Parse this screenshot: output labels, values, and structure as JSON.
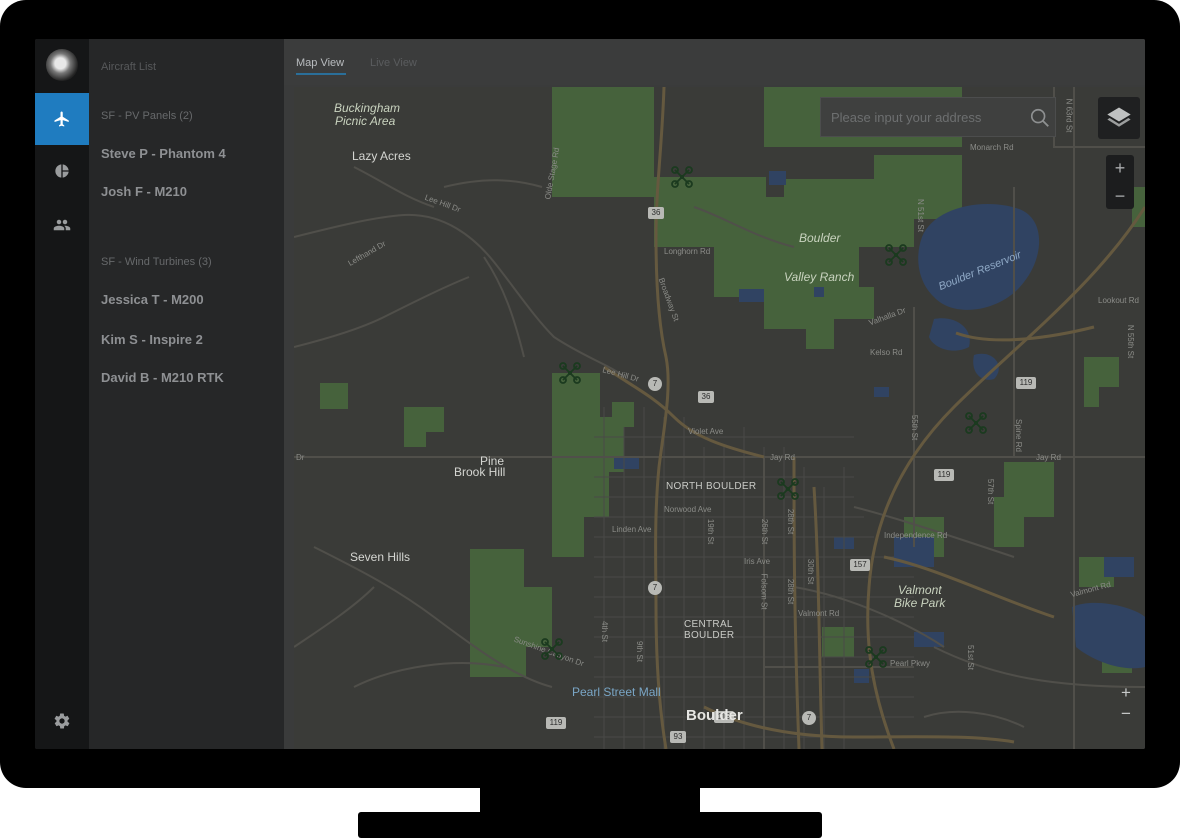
{
  "rail": {
    "icons": [
      "logo-icon",
      "airplane-icon",
      "pie-chart-icon",
      "users-icon",
      "gear-icon"
    ],
    "active": "airplane-icon",
    "accent": "#1f7cc0"
  },
  "sidebar": {
    "title": "Aircraft List",
    "groups": [
      {
        "label": "SF - PV Panels (2)",
        "items": [
          "Steve P - Phantom 4",
          "Josh F - M210"
        ]
      },
      {
        "label": "SF - Wind Turbines (3)",
        "items": [
          "Jessica T - M200",
          "Kim S - Inspire 2",
          "David B - M210 RTK"
        ]
      }
    ]
  },
  "tabs": [
    {
      "label": "Map View",
      "active": true
    },
    {
      "label": "Live View",
      "active": false
    }
  ],
  "search": {
    "placeholder": "Please input your address"
  },
  "map_controls": {
    "zoom_in": "+",
    "zoom_out": "−"
  },
  "map_labels": {
    "buckingham_1": "Buckingham",
    "buckingham_2": "Picnic Area",
    "lazy_acres": "Lazy Acres",
    "bvr_1": "Boulder",
    "bvr_2": "Valley Ranch",
    "reservoir": "Boulder Reservoir",
    "pine_1": "Pine",
    "pine_2": "Brook Hill",
    "seven_hills": "Seven Hills",
    "north_boulder": "NORTH BOULDER",
    "central_1": "CENTRAL",
    "central_2": "BOULDER",
    "valmont_1": "Valmont",
    "valmont_2": "Bike Park",
    "pearl": "Pearl Street Mall",
    "boulder": "Boulder",
    "lee_hill": "Lee Hill Dr",
    "lee_hill_2": "Lee Hill Dr",
    "olde_stage": "Olde Stage Rd",
    "longhorn": "Longhorn Rd",
    "broadway": "Broadway St",
    "monarch": "Monarch Rd",
    "n63": "N 63rd St",
    "n51": "N 51st St",
    "valhalla": "Valhalla Dr",
    "kelso": "Kelso Rd",
    "lookout": "Lookout Rd",
    "violet": "Violet Ave",
    "jay1": "Jay Rd",
    "jay2": "Jay Rd",
    "norwood": "Norwood Ave",
    "linden": "Linden Ave",
    "iris": "Iris Ave",
    "st28": "28th St",
    "st28b": "28th St",
    "st26": "26th St",
    "st19": "19th St",
    "st30": "30th St",
    "st4": "4th St",
    "st9": "9th St",
    "folsom": "Folsom St",
    "valmont_rd": "Valmont Rd",
    "independence": "Independence Rd",
    "pearl_pkwy": "Pearl Pkwy",
    "spine": "Spine Rd",
    "st55": "55th St",
    "st51": "51st St",
    "valmont_rd2": "Valmont Rd",
    "sunshine": "Sunshine Canyon Dr",
    "lefthand": "Lefthand Dr",
    "dr": "Dr",
    "st57": "57th St",
    "n55": "N 55th St"
  },
  "highway_shields": [
    "36",
    "36",
    "7",
    "7",
    "119",
    "119",
    "119",
    "157",
    "7",
    "119",
    "93"
  ],
  "colors": {
    "map_bg": "#3d3e3b",
    "park": "#4a6a3f",
    "water": "#32476a",
    "road": "#4d4c48",
    "highway": "#6e6043"
  }
}
